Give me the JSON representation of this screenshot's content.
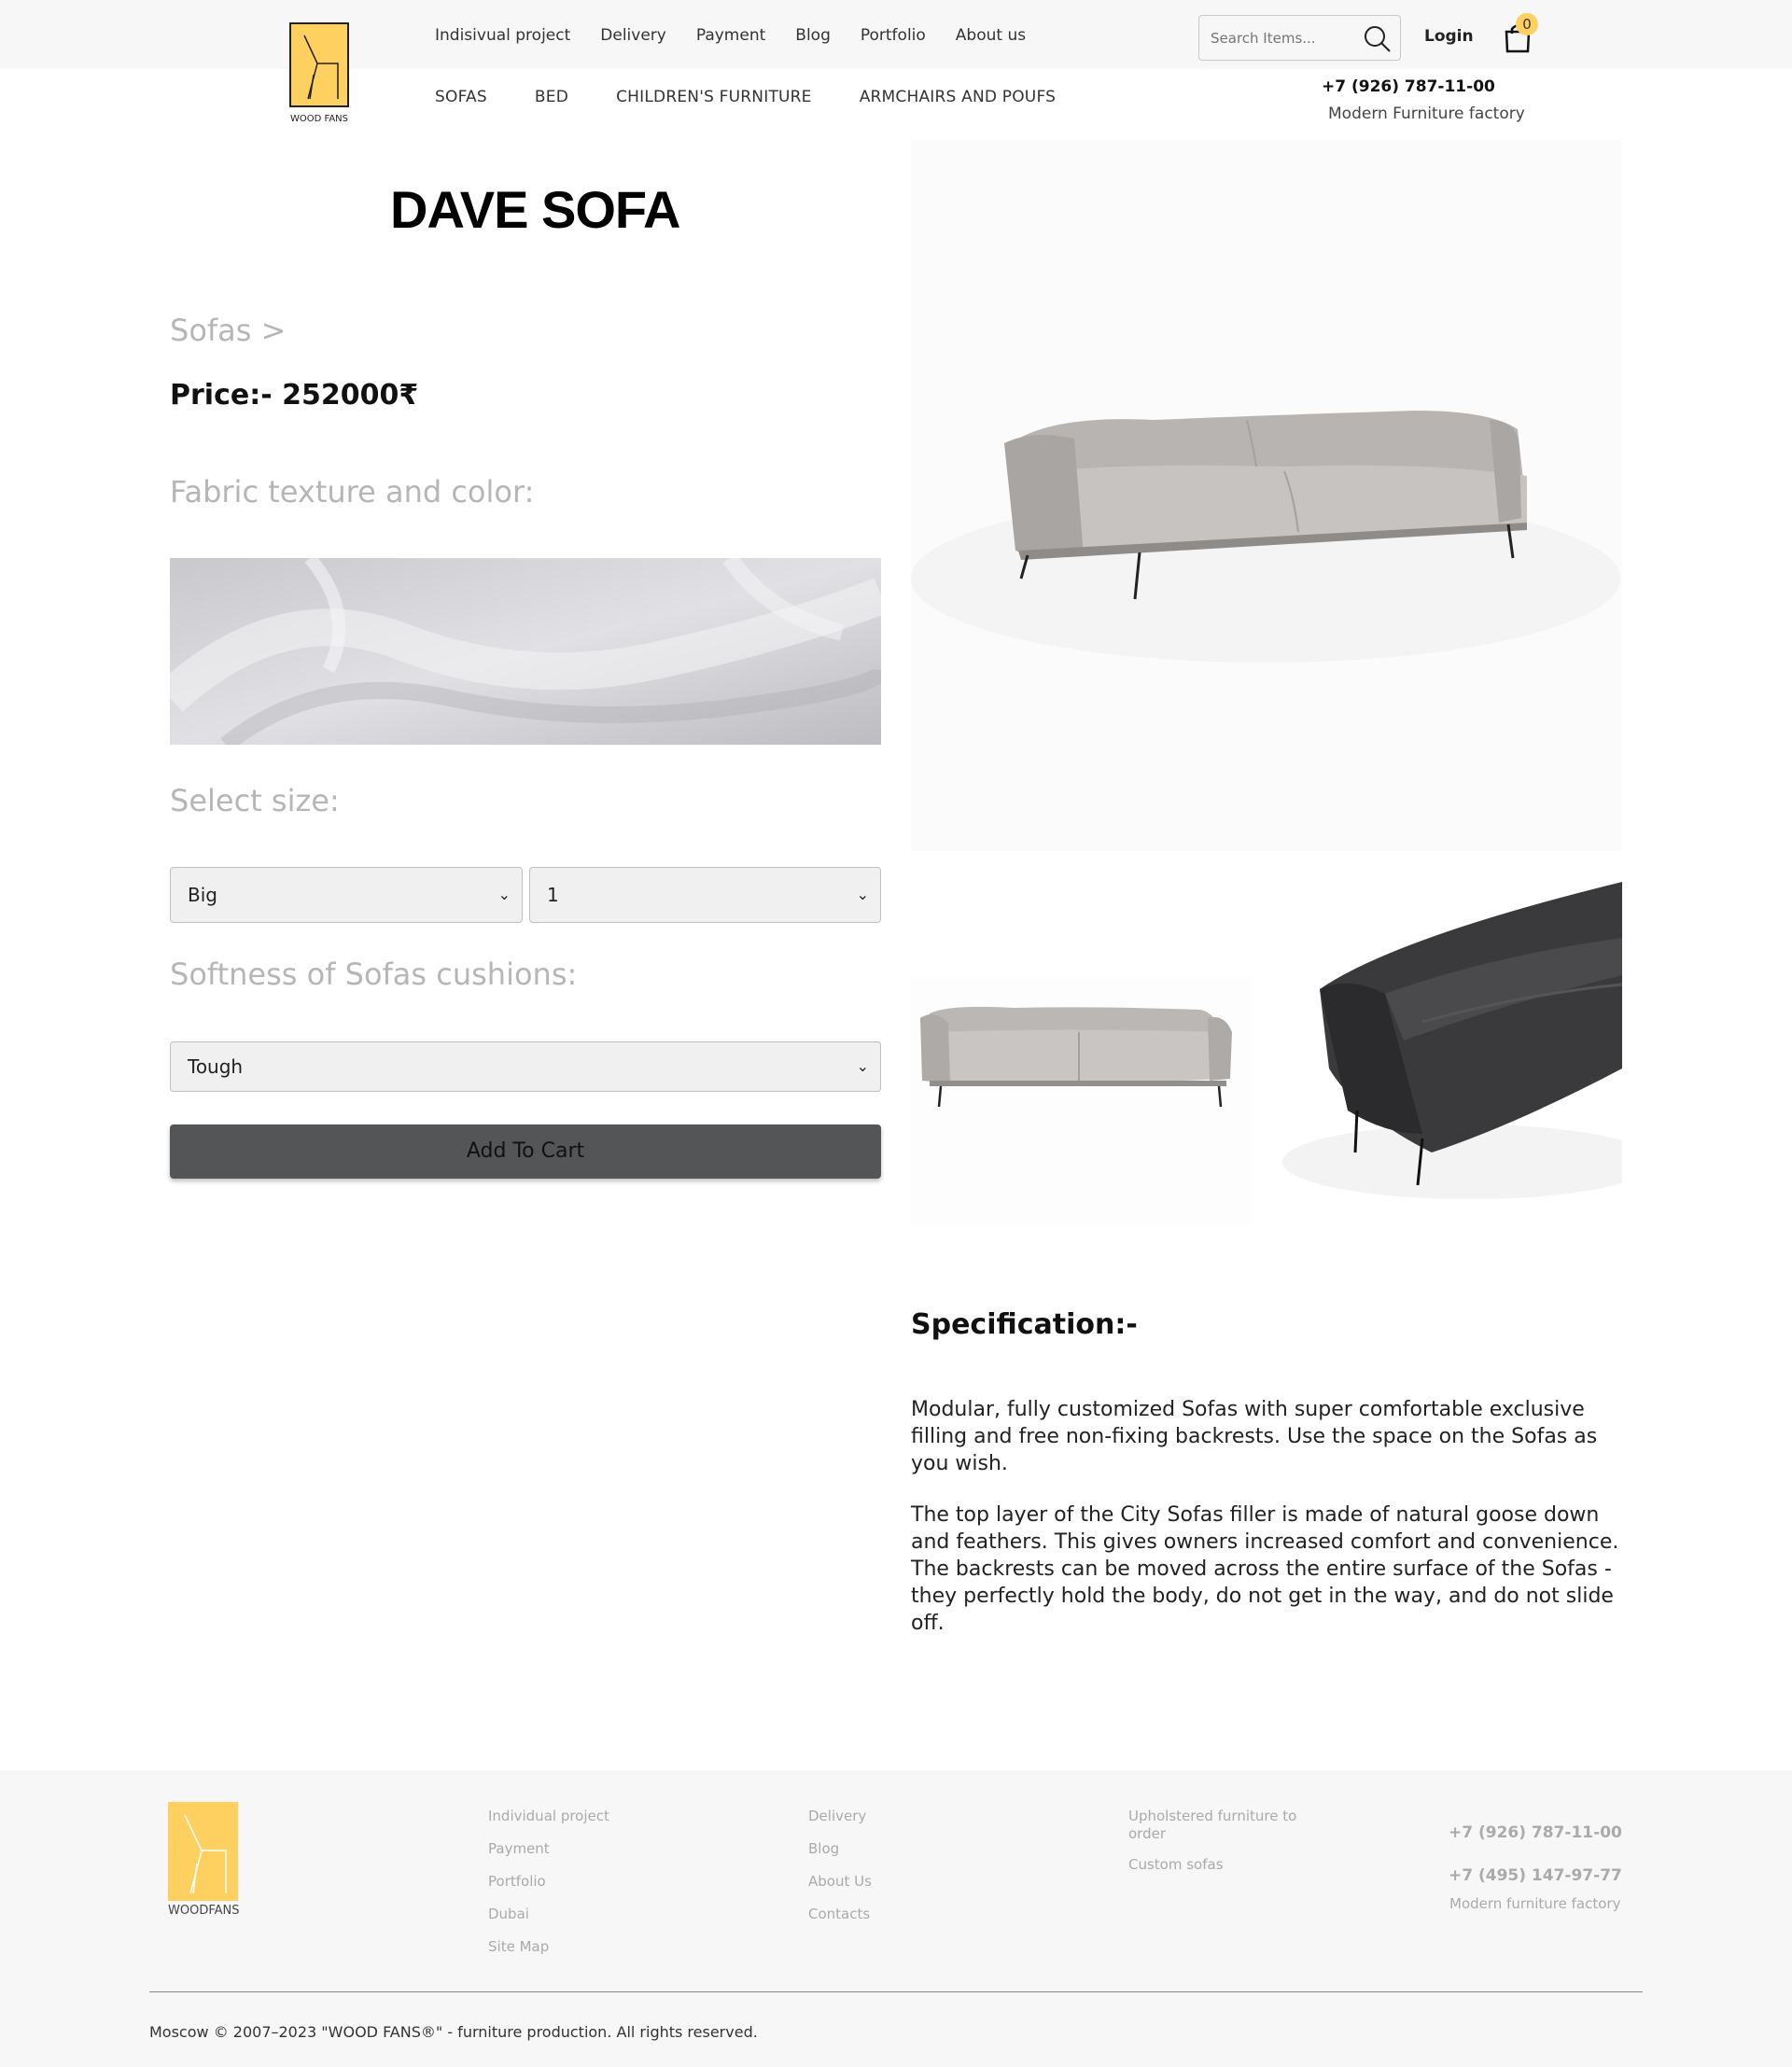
{
  "header": {
    "logo_text": "WOOD FANS",
    "top_nav": [
      "Indisivual project",
      "Delivery",
      "Payment",
      "Blog",
      "Portfolio",
      "About us"
    ],
    "search_placeholder": "Search Items...",
    "login_label": "Login",
    "cart_count": "0",
    "categories": [
      "SOFAS",
      "BED",
      "CHILDREN'S FURNITURE",
      "ARMCHAIRS AND POUFS"
    ],
    "phone": "+7 (926) 787-11-00",
    "tagline": "Modern Furniture factory"
  },
  "product": {
    "title": "DAVE SOFA",
    "breadcrumb": "Sofas >",
    "price": "Price:- 252000₹",
    "fabric_label": "Fabric texture and color:",
    "size_label": "Select size:",
    "size_value": "Big",
    "quantity_value": "1",
    "softness_label": "Softness of Sofas cushions:",
    "softness_value": "Tough",
    "add_to_cart": "Add To Cart",
    "spec_title": "Specification:-",
    "spec_p1": "Modular, fully customized Sofas with super comfortable exclusive filling and free non-fixing backrests. Use the space on the Sofas as you wish.",
    "spec_p2": "The top layer of the City Sofas filler is made of natural goose down and feathers. This gives owners increased comfort and convenience. The backrests can be moved across the entire surface of the Sofas - they perfectly hold the body, do not get in the way, and do not slide off."
  },
  "footer": {
    "logo_text": "WOODFANS",
    "col1": [
      "Individual project",
      "Payment",
      "Portfolio",
      "Dubai",
      "Site Map"
    ],
    "col2": [
      "Delivery",
      "Blog",
      "About Us",
      "Contacts"
    ],
    "col3": [
      "Upholstered furniture to order",
      "Custom sofas"
    ],
    "phone1": "+7 (926) 787-11-00",
    "phone2": "+7 (495) 147-97-77",
    "tagline": "Modern furniture factory",
    "copyright": "Moscow © 2007–2023 \"WOOD FANS®\" - furniture production. All rights reserved."
  },
  "colors": {
    "accent": "#fdd05f",
    "button": "#545557",
    "muted_label": "#b6b6b6"
  }
}
